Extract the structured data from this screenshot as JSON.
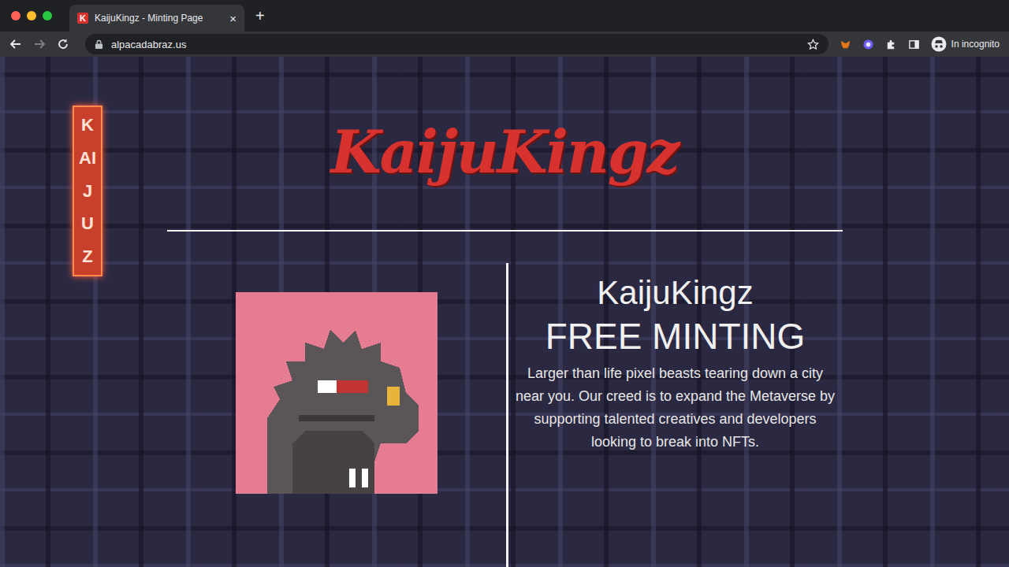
{
  "browser": {
    "tab": {
      "title": "KaijuKingz - Minting Page",
      "favicon": "K",
      "close": "×"
    },
    "new_tab": "+",
    "url": "alpacadabraz.us",
    "profile": "In incognito"
  },
  "page": {
    "sign": "KAIJUZ",
    "logo": "KaijuKingz",
    "title": "KaijuKingz",
    "headline": "FREE MINTING",
    "description": "Larger than life pixel beasts tearing down a city near you. Our creed is to expand the Metaverse by supporting talented creatives and developers looking to break into NFTs.",
    "loading": true
  }
}
